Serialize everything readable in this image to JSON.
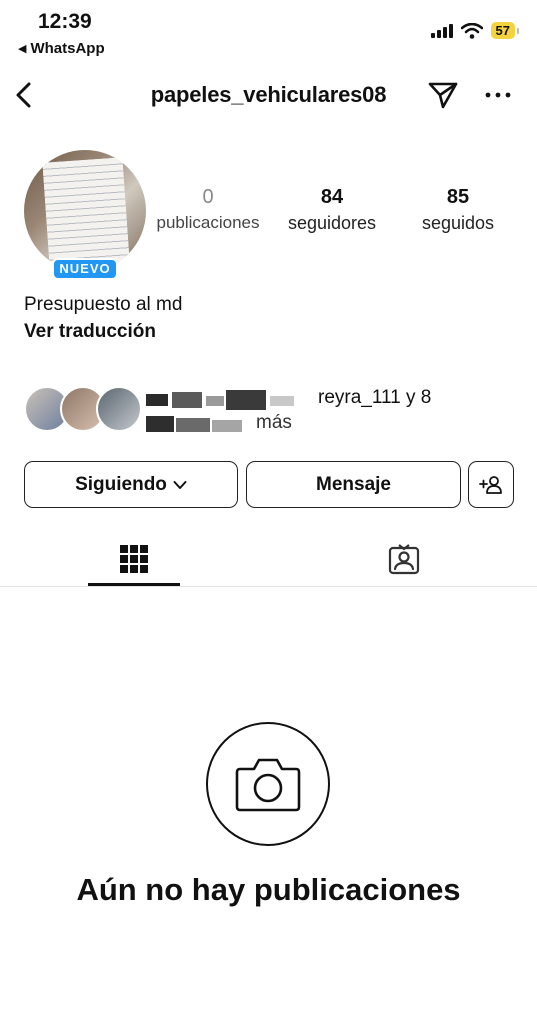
{
  "status_bar": {
    "time": "12:39",
    "back_app": "WhatsApp",
    "battery": "57"
  },
  "header": {
    "username": "papeles_vehiculares08"
  },
  "profile": {
    "badge": "NUEVO",
    "stats": [
      {
        "value": "0",
        "label": "publicaciones"
      },
      {
        "value": "84",
        "label": "seguidores"
      },
      {
        "value": "85",
        "label": "seguidos"
      }
    ],
    "bio": "Presupuesto al md",
    "translate_link": "Ver traducción",
    "followed_by_line1": "reyra_111 y 8",
    "followed_by_line2": "más"
  },
  "actions": {
    "following_label": "Siguiendo",
    "message_label": "Mensaje"
  },
  "empty_state": {
    "title": "Aún no hay publicaciones"
  },
  "colors": {
    "badge_blue": "#2196f3",
    "battery_yellow": "#f5d33e"
  }
}
